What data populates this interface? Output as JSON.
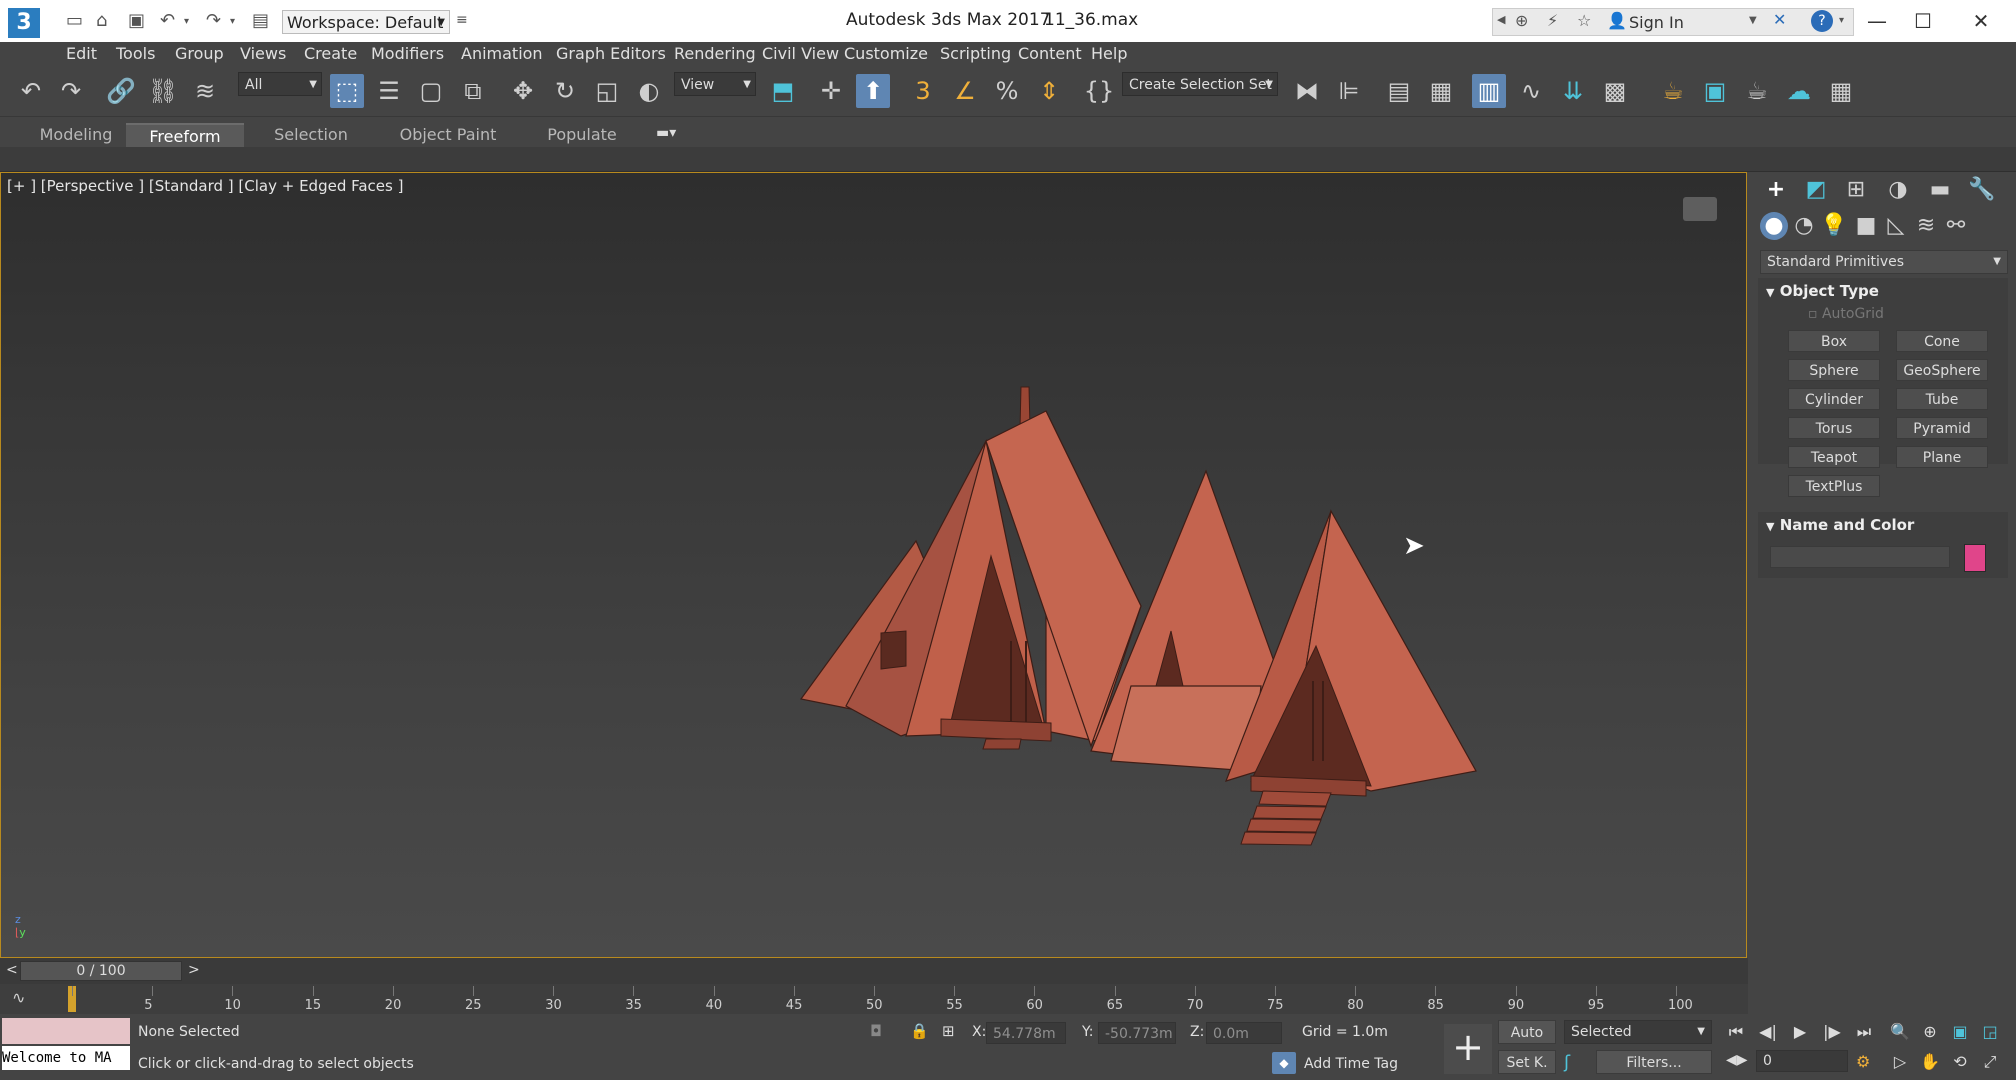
{
  "titlebar": {
    "app_title": "Autodesk 3ds Max 2017",
    "file_name": "11_36.max",
    "workspace_label": "Workspace: Default",
    "sign_in": "Sign In",
    "logo_text": "3"
  },
  "menu": {
    "items": [
      "Edit",
      "Tools",
      "Group",
      "Views",
      "Create",
      "Modifiers",
      "Animation",
      "Graph Editors",
      "Rendering",
      "Civil View",
      "Customize",
      "Scripting",
      "Content",
      "Help"
    ]
  },
  "toolbar": {
    "filter_value": "All",
    "refcoord_value": "View",
    "selection_set_value": "Create Selection Set"
  },
  "ribbon": {
    "tabs": [
      "Modeling",
      "Freeform",
      "Selection",
      "Object Paint",
      "Populate"
    ],
    "active_tab": "Freeform"
  },
  "viewport": {
    "label": "[+ ] [Perspective ]  [Standard ]  [Clay + Edged Faces ]",
    "model_color": "#b85843"
  },
  "command_panel": {
    "category_value": "Standard Primitives",
    "object_type": {
      "title": "Object Type",
      "autogrid": "AutoGrid",
      "buttons": [
        "Box",
        "Cone",
        "Sphere",
        "GeoSphere",
        "Cylinder",
        "Tube",
        "Torus",
        "Pyramid",
        "Teapot",
        "Plane",
        "TextPlus"
      ]
    },
    "name_color": {
      "title": "Name and Color",
      "name_value": "",
      "swatch_color": "#e0458a"
    }
  },
  "timeline": {
    "frame_counter": "0 / 100",
    "prev": "<",
    "next": ">",
    "ticks": [
      "0",
      "5",
      "10",
      "15",
      "20",
      "25",
      "30",
      "35",
      "40",
      "45",
      "50",
      "55",
      "60",
      "65",
      "70",
      "75",
      "80",
      "85",
      "90",
      "95",
      "100"
    ]
  },
  "status": {
    "listener_text": "Welcome to MA",
    "selection_status": "None Selected",
    "prompt": "Click or click-and-drag to select objects",
    "x_label": "X:",
    "x_value": "54.778m",
    "y_label": "Y:",
    "y_value": "-50.773m",
    "z_label": "Z:",
    "z_value": "0.0m",
    "grid": "Grid = 1.0m",
    "add_time_tag": "Add Time Tag",
    "auto_key": "Auto",
    "set_key": "Set K.",
    "key_mode_value": "Selected",
    "filters": "Filters...",
    "current_frame": "0"
  }
}
